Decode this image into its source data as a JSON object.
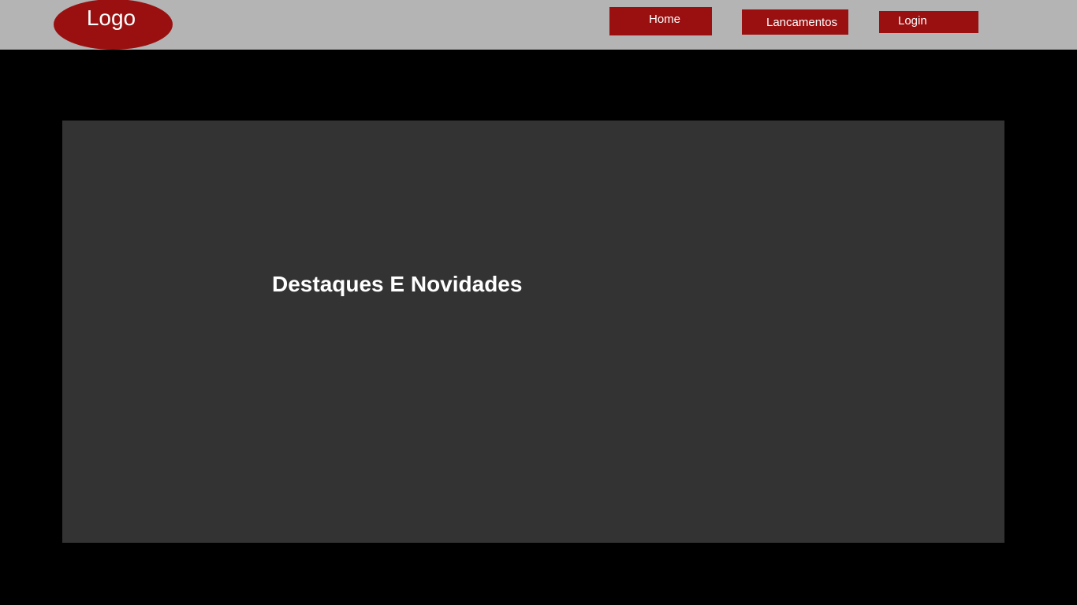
{
  "header": {
    "logo_text": "Logo",
    "nav": {
      "home": "Home",
      "lancamentos": "Lancamentos",
      "login": "Login"
    }
  },
  "main": {
    "hero_title": "Destaques E Novidades"
  },
  "colors": {
    "header_background": "#b4b4b4",
    "accent": "#9a1010",
    "page_background": "#000000",
    "hero_background": "#333333",
    "text": "#ffffff"
  }
}
